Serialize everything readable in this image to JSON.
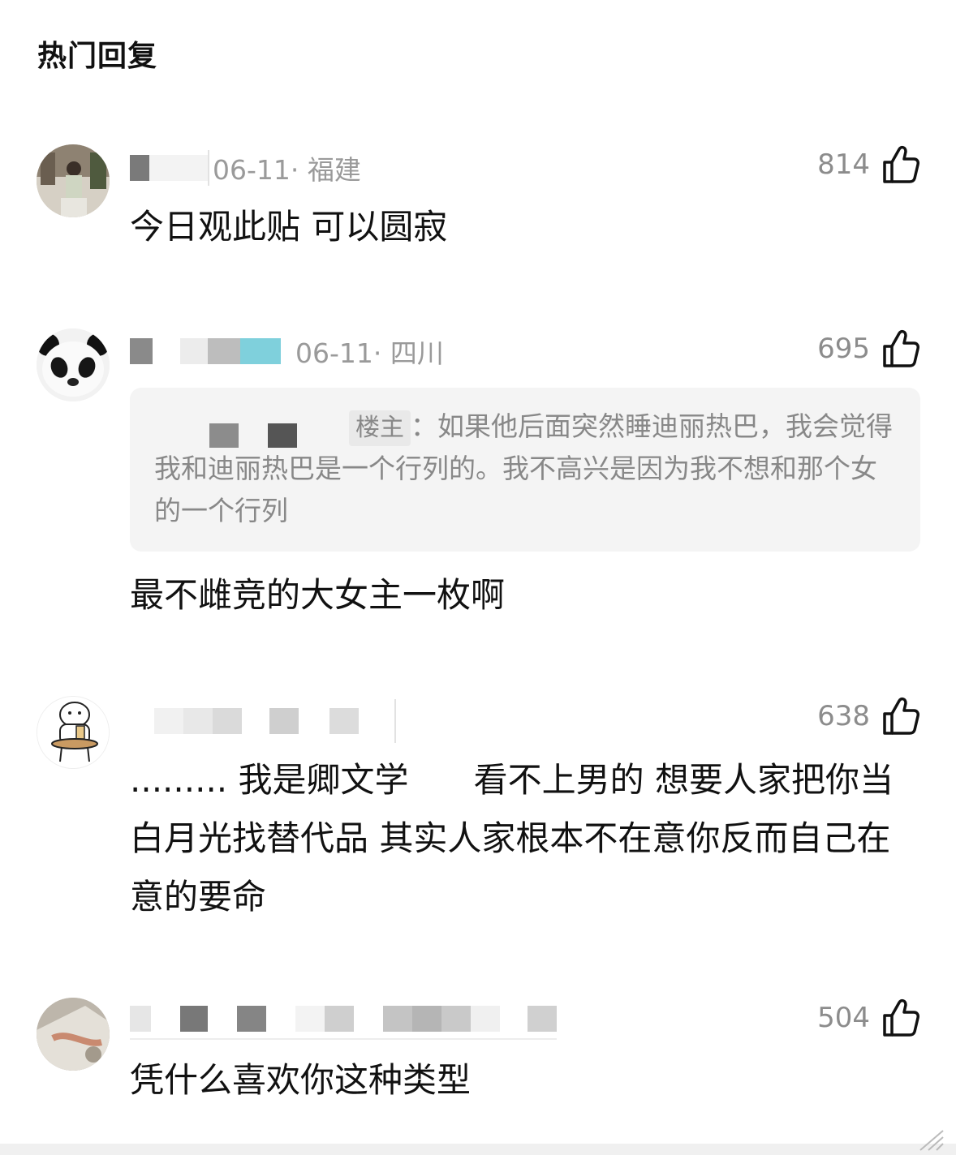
{
  "section": {
    "title": "热门回复"
  },
  "colors": {
    "meta": "#9a9a9a",
    "quote_bg": "#f4f4f4",
    "text": "#111111"
  },
  "comments": [
    {
      "meta": "06-11· 福建",
      "likes": "814",
      "text": "今日观此贴 可以圆寂",
      "avatar": "person-photo-avatar"
    },
    {
      "meta": "06-11· 四川",
      "likes": "695",
      "quote": {
        "tag": "楼主",
        "text": "：如果他后面突然睡迪丽热巴，我会觉得我和迪丽热巴是一个行列的。我不高兴是因为我不想和那个女的一个行列"
      },
      "text": "最不雌竞的大女主一枚啊",
      "avatar": "panda-avatar"
    },
    {
      "meta": "",
      "likes": "638",
      "text": "......... 我是卿文学      看不上男的 想要人家把你当白月光找替代品 其实人家根本不在意你反而自己在意的要命",
      "avatar": "cartoon-bear-avatar"
    },
    {
      "meta": "",
      "likes": "504",
      "text": "凭什么喜欢你这种类型",
      "avatar": "photo-avatar"
    }
  ]
}
